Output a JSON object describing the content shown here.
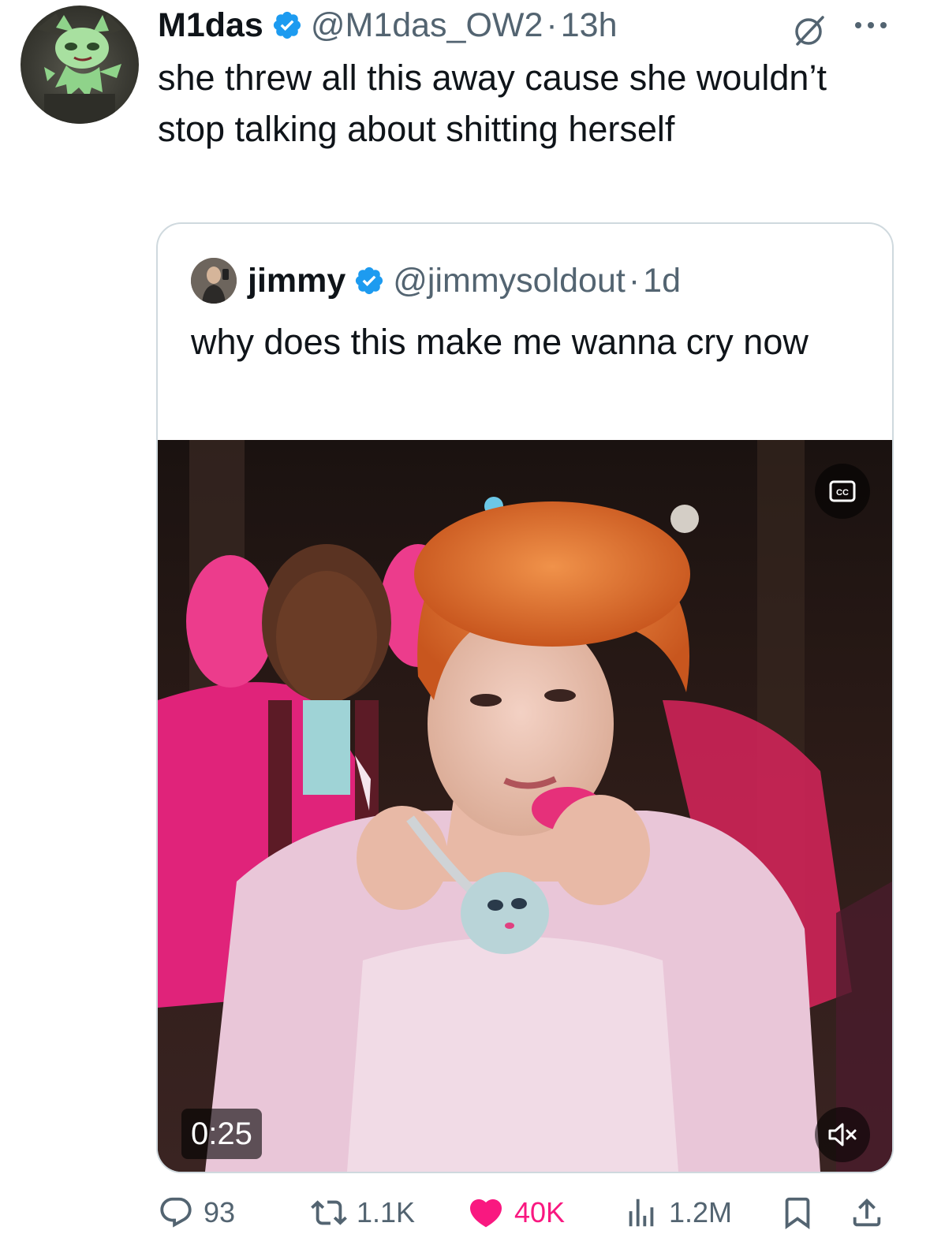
{
  "tweet": {
    "author": {
      "display_name": "M1das",
      "handle": "@M1das_OW2",
      "verified": true,
      "avatar_icon": "green-cat-character-avatar"
    },
    "separator": "·",
    "time": "13h",
    "text": "she threw all this away cause she wouldn’t stop talking about shitting herself"
  },
  "quote": {
    "author": {
      "display_name": "jimmy",
      "handle": "@jimmysoldout",
      "verified": true
    },
    "separator": "·",
    "time": "1d",
    "text": "why does this make me wanna cry now",
    "video": {
      "duration": "0:25",
      "cc_icon": "closed-captions-icon",
      "mute_icon": "muted-speaker-icon"
    }
  },
  "actions": {
    "replies": "93",
    "reposts": "1.1K",
    "likes": "40K",
    "views": "1.2M",
    "liked": true
  },
  "colors": {
    "verified_blue": "#1d9bf0",
    "like_pink": "#f91880",
    "secondary_text": "#536471",
    "card_border": "#cfd9de"
  }
}
